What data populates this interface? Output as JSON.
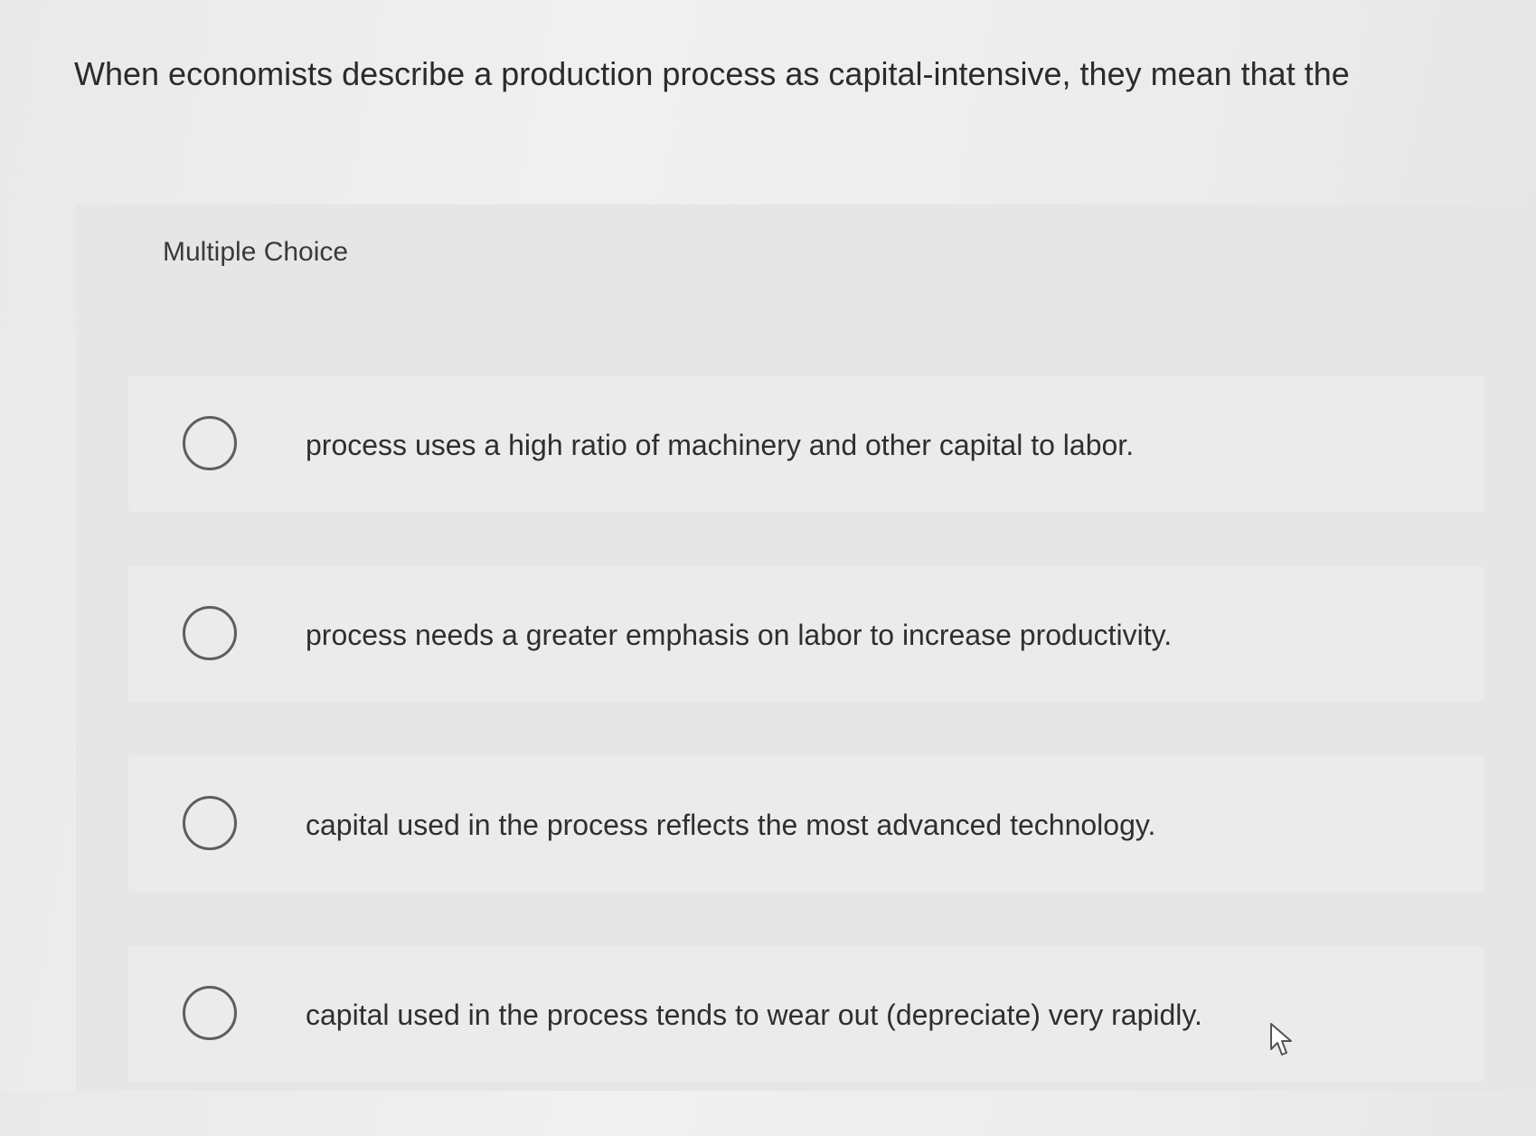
{
  "question": {
    "text": "When economists describe a production process as capital-intensive, they mean that the"
  },
  "multiple_choice": {
    "header": "Multiple Choice",
    "options": [
      {
        "label": "process uses a high ratio of machinery and other capital to labor.",
        "selected": false
      },
      {
        "label": "process needs a greater emphasis on labor to increase productivity.",
        "selected": false
      },
      {
        "label": "capital used in the process reflects the most advanced technology.",
        "selected": false
      },
      {
        "label": "capital used in the process tends to wear out (depreciate) very rapidly.",
        "selected": false
      }
    ]
  },
  "icons": {
    "radio": "radio-button-icon",
    "cursor": "mouse-pointer-icon"
  }
}
